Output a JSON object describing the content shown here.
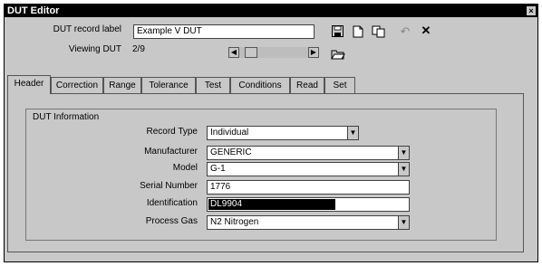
{
  "window": {
    "title": "DUT Editor",
    "close_glyph": "×"
  },
  "header": {
    "record_label_caption": "DUT record label",
    "record_label_value": "Example V DUT",
    "viewing_caption": "Viewing DUT",
    "viewing_value": "2/9"
  },
  "toolbar": {
    "icons": [
      "save-icon",
      "new-document-icon",
      "copy-icon",
      "undo-icon",
      "delete-icon",
      "open-folder-icon"
    ]
  },
  "tabs": [
    "Header",
    "Correction",
    "Range",
    "Tolerance",
    "Test",
    "Conditions",
    "Read",
    "Set"
  ],
  "active_tab": "Header",
  "group": {
    "title": "DUT Information",
    "record_type_label": "Record Type",
    "record_type_value": "Individual",
    "manufacturer_label": "Manufacturer",
    "manufacturer_value": "GENERIC",
    "model_label": "Model",
    "model_value": "G-1",
    "serial_label": "Serial Number",
    "serial_value": "1776",
    "identification_label": "Identification",
    "identification_value": "DL9904",
    "process_gas_label": "Process Gas",
    "process_gas_value": "N2 Nitrogen"
  }
}
